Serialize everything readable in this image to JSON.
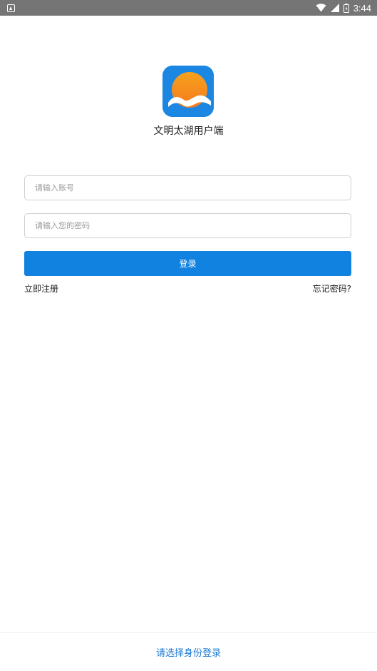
{
  "status_bar": {
    "time": "3:44",
    "icons": [
      "notification-icon",
      "wifi-icon",
      "signal-icon",
      "battery-icon"
    ]
  },
  "app": {
    "name": "文明太湖用户端",
    "logo": "sun-over-waves-logo"
  },
  "login_form": {
    "account_placeholder": "请输入账号",
    "password_placeholder": "请输入您的密码",
    "login_label": "登录",
    "register_label": "立即注册",
    "forgot_label": "忘记密码?"
  },
  "footer": {
    "role_select_label": "请选择身份登录"
  },
  "colors": {
    "primary": "#1282e0",
    "link": "#1a7ad6",
    "status_bar": "#757575",
    "logo_bg": "#1c87e3",
    "sun": "#f7a21b"
  }
}
